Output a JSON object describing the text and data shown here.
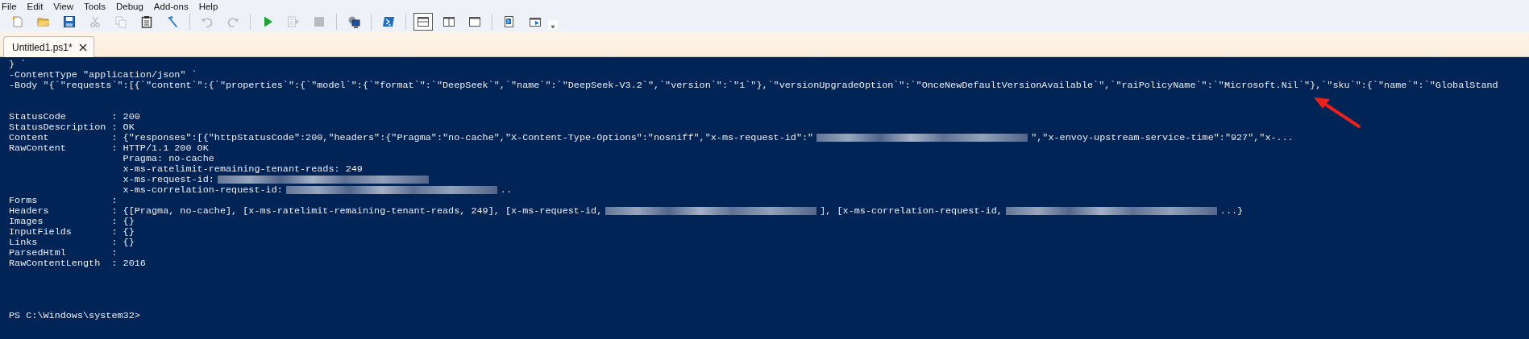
{
  "menu": [
    "File",
    "Edit",
    "View",
    "Tools",
    "Debug",
    "Add-ons",
    "Help"
  ],
  "toolbar": [
    {
      "kind": "new",
      "disabled": false
    },
    {
      "kind": "open",
      "disabled": false
    },
    {
      "kind": "save",
      "disabled": false
    },
    {
      "kind": "cut",
      "disabled": true
    },
    {
      "kind": "copy",
      "disabled": true
    },
    {
      "kind": "paste",
      "disabled": false
    },
    {
      "kind": "clear",
      "disabled": false
    },
    {
      "kind": "sep"
    },
    {
      "kind": "undo",
      "disabled": true
    },
    {
      "kind": "redo",
      "disabled": true
    },
    {
      "kind": "sep"
    },
    {
      "kind": "run",
      "disabled": false
    },
    {
      "kind": "run-selection",
      "disabled": true
    },
    {
      "kind": "stop",
      "disabled": true
    },
    {
      "kind": "sep"
    },
    {
      "kind": "remote",
      "disabled": false
    },
    {
      "kind": "sep"
    },
    {
      "kind": "console",
      "disabled": false
    },
    {
      "kind": "sep"
    },
    {
      "kind": "layout-top",
      "selected": true
    },
    {
      "kind": "layout-right",
      "selected": false
    },
    {
      "kind": "layout-max",
      "selected": false
    },
    {
      "kind": "sep"
    },
    {
      "kind": "show-script",
      "disabled": false
    },
    {
      "kind": "show-commands",
      "disabled": false
    },
    {
      "kind": "overflow",
      "disabled": false
    }
  ],
  "tabs": [
    {
      "label": "Untitled1.ps1*",
      "selected": true
    }
  ],
  "console": {
    "lines": [
      {
        "kind": "plain",
        "parts": [
          {
            "text": "} `"
          }
        ]
      },
      {
        "kind": "plain",
        "parts": [
          {
            "text": "-ContentType \"application/json\" `"
          }
        ]
      },
      {
        "kind": "plain",
        "parts": [
          {
            "text": "-Body \"{`\"requests`\":[{`\"content`\":{`\"properties`\":{`\"model`\":{`\"format`\":`\"DeepSeek`\",`\"name`\":`\"DeepSeek-V3.2`\",`\"version`\":`\"1`\"},`\"versionUpgradeOption`\":`\"OnceNewDefaultVersionAvailable`\",`\"raiPolicyName`\":`\"Microsoft.Nil`\"},`\"sku`\":{`\"name`\":`\"GlobalStand"
          }
        ]
      },
      {
        "kind": "blank"
      },
      {
        "kind": "blank"
      },
      {
        "kind": "property",
        "name": "StatusCode",
        "parts": [
          {
            "text": ": 200"
          }
        ]
      },
      {
        "kind": "property",
        "name": "StatusDescription",
        "parts": [
          {
            "text": ": OK"
          }
        ]
      },
      {
        "kind": "property",
        "name": "Content",
        "parts": [
          {
            "text": ": {\"responses\":[{\"httpStatusCode\":200,\"headers\":{\"Pragma\":\"no-cache\",\"X-Content-Type-Options\":\"nosniff\",\"x-ms-request-id\":\""
          },
          {
            "kind": "redacted"
          },
          {
            "text": "\",\"x-envoy-upstream-service-time\":\"927\",\"x-..."
          }
        ]
      },
      {
        "kind": "property",
        "name": "RawContent",
        "parts": [
          {
            "text": ": HTTP/1.1 200 OK"
          }
        ]
      },
      {
        "kind": "continuation",
        "parts": [
          {
            "text": "Pragma: no-cache"
          }
        ]
      },
      {
        "kind": "continuation",
        "parts": [
          {
            "text": "x-ms-ratelimit-remaining-tenant-reads: 249"
          }
        ]
      },
      {
        "kind": "continuation",
        "parts": [
          {
            "text": "x-ms-request-id:"
          },
          {
            "kind": "redacted"
          }
        ]
      },
      {
        "kind": "continuation",
        "parts": [
          {
            "text": "x-ms-correlation-request-id:"
          },
          {
            "kind": "redacted"
          },
          {
            "text": ".."
          }
        ]
      },
      {
        "kind": "property",
        "name": "Forms",
        "parts": [
          {
            "text": ":"
          }
        ]
      },
      {
        "kind": "property",
        "name": "Headers",
        "parts": [
          {
            "text": ": {[Pragma, no-cache], [x-ms-ratelimit-remaining-tenant-reads, 249], [x-ms-request-id,"
          },
          {
            "kind": "redacted"
          },
          {
            "text": "], [x-ms-correlation-request-id,"
          },
          {
            "kind": "redacted"
          },
          {
            "text": "...}"
          }
        ]
      },
      {
        "kind": "property",
        "name": "Images",
        "parts": [
          {
            "text": ": {}"
          }
        ]
      },
      {
        "kind": "property",
        "name": "InputFields",
        "parts": [
          {
            "text": ": {}"
          }
        ]
      },
      {
        "kind": "property",
        "name": "Links",
        "parts": [
          {
            "text": ": {}"
          }
        ]
      },
      {
        "kind": "property",
        "name": "ParsedHtml",
        "parts": [
          {
            "text": ":"
          }
        ]
      },
      {
        "kind": "property",
        "name": "RawContentLength",
        "parts": [
          {
            "text": ": 2016"
          }
        ]
      },
      {
        "kind": "blank"
      },
      {
        "kind": "blank"
      },
      {
        "kind": "blank"
      },
      {
        "kind": "blank"
      },
      {
        "kind": "plain",
        "parts": [
          {
            "text": "PS C:\\Windows\\system32>"
          }
        ]
      }
    ]
  },
  "annotation": {
    "kind": "arrow"
  }
}
